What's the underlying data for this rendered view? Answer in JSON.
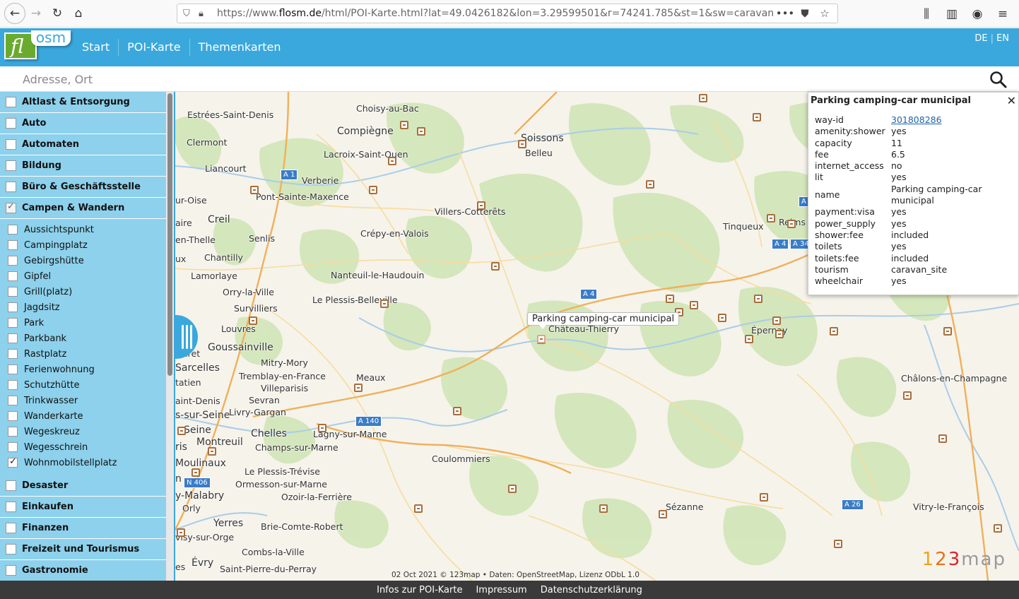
{
  "browser": {
    "url_prefix": "https://www.",
    "url_domain": "flosm.de",
    "url_path": "/html/POI-Karte.html?lat=49.0426182&lon=3.29599501&r=74241.785&st=1&sw=caravan"
  },
  "header": {
    "logo_fl": "fl",
    "logo_osm": "osm",
    "menu": [
      "Start",
      "POI-Karte",
      "Themenkarten"
    ],
    "lang": [
      "DE",
      "EN"
    ]
  },
  "search": {
    "placeholder": "Adresse, Ort"
  },
  "sidebar": {
    "categories_top": [
      {
        "label": "Altlast & Entsorgung",
        "checked": false
      },
      {
        "label": "Auto",
        "checked": false
      },
      {
        "label": "Automaten",
        "checked": false
      },
      {
        "label": "Bildung",
        "checked": false
      },
      {
        "label": "Büro & Geschäftsstelle",
        "checked": false
      },
      {
        "label": "Campen & Wandern",
        "checked": true
      }
    ],
    "subcategories": [
      {
        "label": "Aussichtspunkt",
        "checked": false
      },
      {
        "label": "Campingplatz",
        "checked": false
      },
      {
        "label": "Gebirgshütte",
        "checked": false
      },
      {
        "label": "Gipfel",
        "checked": false
      },
      {
        "label": "Grill(platz)",
        "checked": false
      },
      {
        "label": "Jagdsitz",
        "checked": false
      },
      {
        "label": "Park",
        "checked": false
      },
      {
        "label": "Parkbank",
        "checked": false
      },
      {
        "label": "Rastplatz",
        "checked": false
      },
      {
        "label": "Ferienwohnung",
        "checked": false
      },
      {
        "label": "Schutzhütte",
        "checked": false
      },
      {
        "label": "Trinkwasser",
        "checked": false
      },
      {
        "label": "Wanderkarte",
        "checked": false
      },
      {
        "label": "Wegeskreuz",
        "checked": false
      },
      {
        "label": "Wegesschrein",
        "checked": false
      },
      {
        "label": "Wohnmobilstellplatz",
        "checked": true
      }
    ],
    "categories_bottom": [
      {
        "label": "Desaster",
        "checked": false
      },
      {
        "label": "Einkaufen",
        "checked": false
      },
      {
        "label": "Finanzen",
        "checked": false
      },
      {
        "label": "Freizeit und Tourismus",
        "checked": false
      },
      {
        "label": "Gastronomie",
        "checked": false
      }
    ]
  },
  "map": {
    "places": [
      {
        "name": "Estrées-Saint-Denis",
        "big": false
      },
      {
        "name": "Choisy-au-Bac",
        "big": false
      },
      {
        "name": "Compiègne",
        "big": true
      },
      {
        "name": "Soissons",
        "big": true
      },
      {
        "name": "Belleu",
        "big": false
      },
      {
        "name": "Clermont",
        "big": false
      },
      {
        "name": "Lacroix-Saint-Ouen",
        "big": false
      },
      {
        "name": "Liancourt",
        "big": false
      },
      {
        "name": "Verberie",
        "big": false
      },
      {
        "name": "ur-Oise",
        "big": false
      },
      {
        "name": "Pont-Sainte-Maxence",
        "big": false
      },
      {
        "name": "Villers-Cotterêts",
        "big": false
      },
      {
        "name": "aire",
        "big": false
      },
      {
        "name": "Creil",
        "big": true
      },
      {
        "name": "Tinqueux",
        "big": false
      },
      {
        "name": "Reims",
        "big": false
      },
      {
        "name": "Senlis",
        "big": false
      },
      {
        "name": "Crépy-en-Valois",
        "big": false
      },
      {
        "name": "en-Thelle",
        "big": false
      },
      {
        "name": "Chantilly",
        "big": false
      },
      {
        "name": "ux",
        "big": false
      },
      {
        "name": "Nanteuil-le-Haudouin",
        "big": false
      },
      {
        "name": "Lamorlaye",
        "big": false
      },
      {
        "name": "Orry-la-Ville",
        "big": false
      },
      {
        "name": "Le Plessis-Belleville",
        "big": false
      },
      {
        "name": "Survilliers",
        "big": false
      },
      {
        "name": "Louvres",
        "big": false
      },
      {
        "name": "Château-Thierry",
        "big": false
      },
      {
        "name": "Épernay",
        "big": false
      },
      {
        "name": "Goussainville",
        "big": true
      },
      {
        "name": "aret",
        "big": false
      },
      {
        "name": "Mitry-Mory",
        "big": false
      },
      {
        "name": "Sarcelles",
        "big": true
      },
      {
        "name": "Tremblay-en-France",
        "big": false
      },
      {
        "name": "Meaux",
        "big": false
      },
      {
        "name": "tatien",
        "big": false
      },
      {
        "name": "Villeparisis",
        "big": false
      },
      {
        "name": "Châlons-en-Champagne",
        "big": false
      },
      {
        "name": "aint-Denis",
        "big": false
      },
      {
        "name": "Sevran",
        "big": false
      },
      {
        "name": "s-sur-Seine",
        "big": true
      },
      {
        "name": "Livry-Gargan",
        "big": false
      },
      {
        "name": "Seine",
        "big": true
      },
      {
        "name": "Chelles",
        "big": true
      },
      {
        "name": "Lagny-sur-Marne",
        "big": false
      },
      {
        "name": "Montreuil",
        "big": true
      },
      {
        "name": "ris",
        "big": true
      },
      {
        "name": "Champs-sur-Marne",
        "big": false
      },
      {
        "name": "Coulommiers",
        "big": false
      },
      {
        "name": "Moulinaux",
        "big": true
      },
      {
        "name": "Le Plessis-Trévise",
        "big": false
      },
      {
        "name": "n",
        "big": true
      },
      {
        "name": "Ormesson-sur-Marne",
        "big": false
      },
      {
        "name": "y-Malabry",
        "big": true
      },
      {
        "name": "Ozoir-la-Ferrière",
        "big": false
      },
      {
        "name": "Orly",
        "big": false
      },
      {
        "name": "Sézanne",
        "big": false
      },
      {
        "name": "Vitry-le-François",
        "big": false
      },
      {
        "name": "Yerres",
        "big": true
      },
      {
        "name": "Brie-Comte-Robert",
        "big": false
      },
      {
        "name": "visy-sur-Orge",
        "big": false
      },
      {
        "name": "Combs-la-Ville",
        "big": false
      },
      {
        "name": "Évry",
        "big": true
      },
      {
        "name": "es",
        "big": false
      },
      {
        "name": "Saint-Pierre-du-Perray",
        "big": false
      }
    ],
    "roads": [
      "A 1",
      "A 4",
      "A 4",
      "A 34",
      "A 4",
      "A",
      "A 140",
      "N 406",
      "A 26"
    ],
    "tooltip": "Parking camping-car municipal",
    "attribution": "02 Oct 2021 © 123map • Daten: OpenStreetMap, Lizenz ODbL 1.0",
    "brand_digits": [
      "1",
      "2",
      "3"
    ],
    "brand_word": "map"
  },
  "info": {
    "title": "Parking camping-car municipal",
    "close": "✕",
    "rows": [
      {
        "key": "way-id",
        "value": "301808286",
        "link": true
      },
      {
        "key": "amenity:shower",
        "value": "yes"
      },
      {
        "key": "capacity",
        "value": "11"
      },
      {
        "key": "fee",
        "value": "6.5"
      },
      {
        "key": "internet_access",
        "value": "no"
      },
      {
        "key": "lit",
        "value": "yes"
      },
      {
        "key": "name",
        "value": "Parking camping-car municipal"
      },
      {
        "key": "payment:visa",
        "value": "yes"
      },
      {
        "key": "power_supply",
        "value": "yes"
      },
      {
        "key": "shower:fee",
        "value": "included"
      },
      {
        "key": "toilets",
        "value": "yes"
      },
      {
        "key": "toilets:fee",
        "value": "included"
      },
      {
        "key": "tourism",
        "value": "caravan_site"
      },
      {
        "key": "wheelchair",
        "value": "yes"
      }
    ]
  },
  "footer": {
    "links": [
      "Infos zur POI-Karte",
      "Impressum",
      "Datenschutzerklärung"
    ]
  },
  "colors": {
    "header": "#3aa8dc",
    "sidebar": "#8dd1ec",
    "footer": "#3a3a3a",
    "poi": "#a86e3c",
    "forest": "#cfe3b2",
    "road_major": "#f3b35a"
  }
}
